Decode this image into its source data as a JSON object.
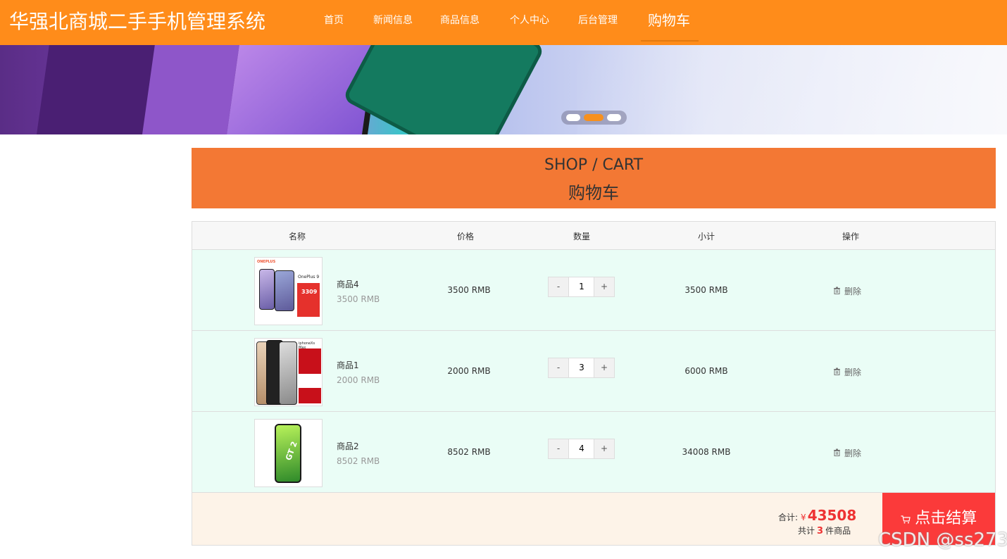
{
  "app": {
    "logo": "华强北商城二手手机管理系统"
  },
  "nav": {
    "items": [
      "首页",
      "新闻信息",
      "商品信息",
      "个人中心",
      "后台管理",
      "购物车"
    ],
    "active_index": 5
  },
  "banner": {
    "slides": 3,
    "active_slide": 1
  },
  "section": {
    "title_en": "SHOP / CART",
    "title_cn": "购物车"
  },
  "table": {
    "headers": [
      "名称",
      "价格",
      "数量",
      "小计",
      "操作"
    ]
  },
  "cart": {
    "items": [
      {
        "name": "商品4",
        "price_sub": "3500 RMB",
        "price": "3500 RMB",
        "qty": "1",
        "subtotal": "3500 RMB",
        "delete_label": "删除",
        "thumb_text": "OnePlus 9",
        "thumb_badge": "ONEPLUS",
        "thumb_price": "3309"
      },
      {
        "name": "商品1",
        "price_sub": "2000 RMB",
        "price": "2000 RMB",
        "qty": "3",
        "subtotal": "6000 RMB",
        "delete_label": "删除",
        "thumb_text": "iphoneXs Max"
      },
      {
        "name": "商品2",
        "price_sub": "8502 RMB",
        "price": "8502 RMB",
        "qty": "4",
        "subtotal": "34008 RMB",
        "delete_label": "删除",
        "thumb_text": "GT 2"
      }
    ],
    "minus_label": "-",
    "plus_label": "+"
  },
  "summary": {
    "total_label": "合计:",
    "currency": "¥",
    "total_amount": "43508",
    "count_prefix": "共计",
    "count": "3",
    "count_suffix": "件商品",
    "checkout_label": "点击结算"
  },
  "watermark": "CSDN @ss273",
  "colors": {
    "header": "#ff8c1a",
    "section": "#f37834",
    "row_bg": "#eafdf6",
    "footer_bg": "#fdf3e8",
    "checkout": "#fb3a3a",
    "accent_red": "#ee3333"
  }
}
